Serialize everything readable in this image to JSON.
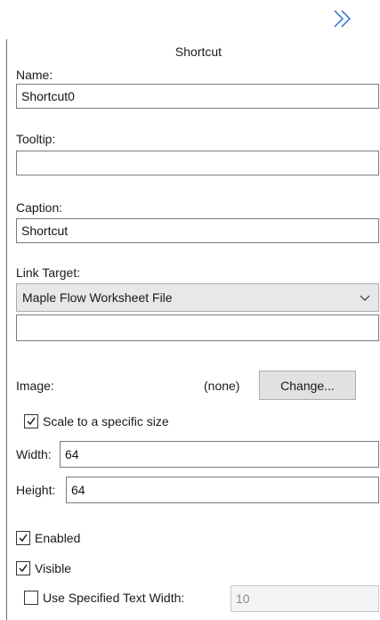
{
  "panel": {
    "title": "Shortcut",
    "collapse_icon": "double-chevron-right-icon"
  },
  "name": {
    "label": "Name:",
    "value": "Shortcut0"
  },
  "tooltip": {
    "label": "Tooltip:",
    "value": ""
  },
  "caption": {
    "label": "Caption:",
    "value": "Shortcut"
  },
  "link_target": {
    "label": "Link Target:",
    "selected": "Maple Flow Worksheet File",
    "value": ""
  },
  "image": {
    "label": "Image:",
    "status": "(none)",
    "change_label": "Change..."
  },
  "scale": {
    "label": "Scale to a specific size",
    "checked": true
  },
  "width": {
    "label": "Width:",
    "value": "64"
  },
  "height": {
    "label": "Height:",
    "value": "64"
  },
  "enabled": {
    "label": "Enabled",
    "checked": true
  },
  "visible": {
    "label": "Visible",
    "checked": true
  },
  "text_width": {
    "label": "Use Specified Text Width:",
    "checked": false,
    "value": "10"
  },
  "colors": {
    "chevron": "#3c7fd6",
    "field_border": "#7a7a7a",
    "dropdown_bg": "#e8e8e8",
    "button_bg": "#e1e1e1"
  }
}
